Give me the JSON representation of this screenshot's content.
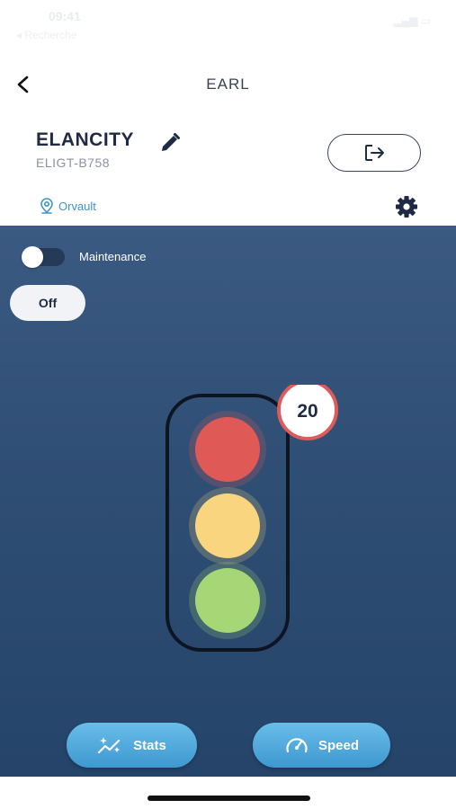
{
  "status_bar": {
    "time": "09:41",
    "back_label": "◂ Recherche",
    "right": "▂▄▆ ▭"
  },
  "nav": {
    "title": "EARL",
    "back_icon": "chevron-left-icon"
  },
  "device": {
    "name": "ELANCITY",
    "id": "ELIGT-B758",
    "location": "Orvault",
    "edit_icon": "pencil-icon",
    "logout_icon": "logout-icon",
    "settings_icon": "gear-icon"
  },
  "controls": {
    "maintenance_label": "Maintenance",
    "maintenance_on": false,
    "mode_label": "Off"
  },
  "traffic_light": {
    "speed_limit": "20",
    "colors": {
      "red": "#df5a57",
      "yellow": "#f8d57e",
      "green": "#a6d676"
    }
  },
  "actions": {
    "stats_label": "Stats",
    "speed_label": "Speed"
  },
  "colors": {
    "accent": "#3d95c9",
    "panel": "#2f4e74",
    "dark": "#1f2a44"
  }
}
